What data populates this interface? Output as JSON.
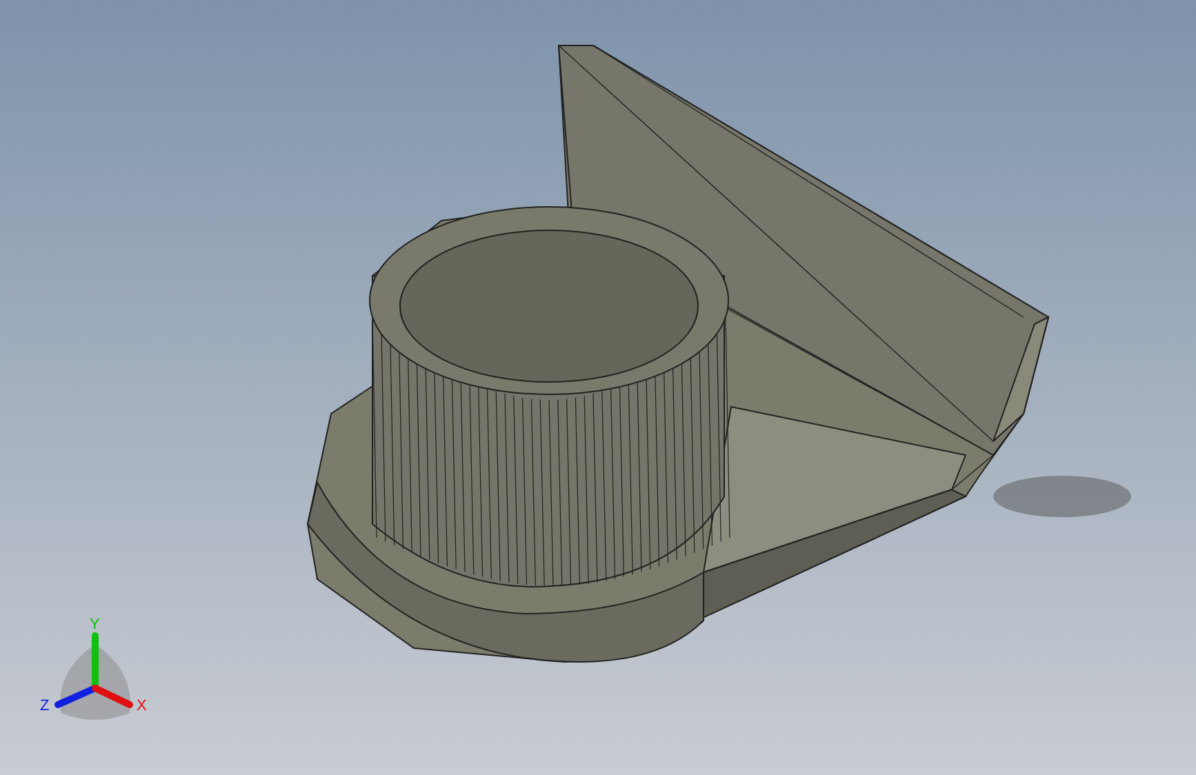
{
  "triad": {
    "axes": [
      {
        "label": "Y",
        "color": "#10c010"
      },
      {
        "label": "Z",
        "color": "#1020e0"
      },
      {
        "label": "X",
        "color": "#e01010"
      }
    ]
  }
}
